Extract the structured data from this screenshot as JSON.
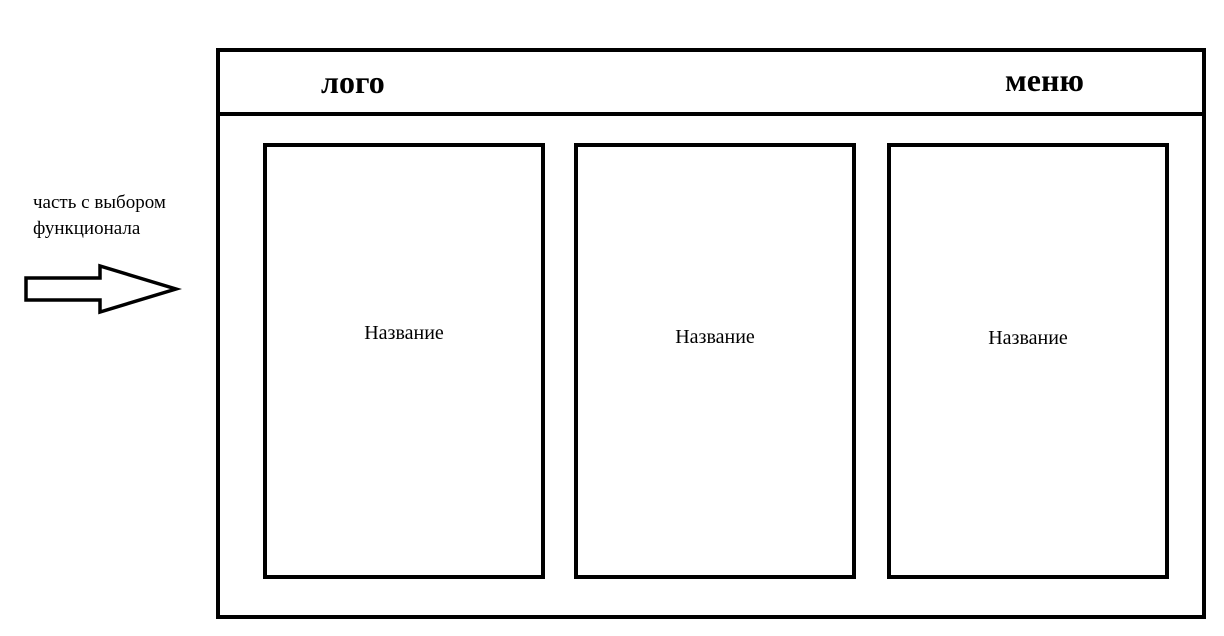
{
  "annotation": {
    "line1": "часть с выбором",
    "line2": "функционала"
  },
  "header": {
    "logo": "лого",
    "menu": "меню"
  },
  "cards": [
    {
      "title": "Название"
    },
    {
      "title": "Название"
    },
    {
      "title": "Название"
    }
  ],
  "icons": {
    "pointer": "right-arrow-icon"
  },
  "colors": {
    "stroke": "#000000",
    "background": "#ffffff"
  }
}
